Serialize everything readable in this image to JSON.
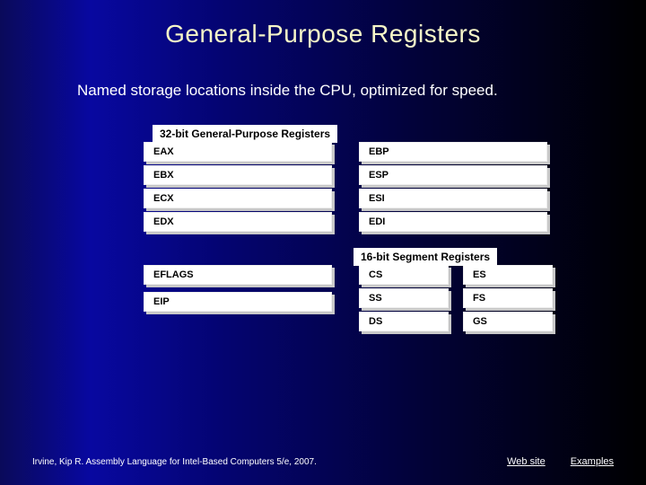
{
  "title": "General-Purpose Registers",
  "subtitle": "Named storage locations inside the CPU, optimized for speed.",
  "section32": {
    "caption": "32-bit General-Purpose Registers",
    "left": [
      "EAX",
      "EBX",
      "ECX",
      "EDX"
    ],
    "right": [
      "EBP",
      "ESP",
      "ESI",
      "EDI"
    ]
  },
  "section16": {
    "caption": "16-bit Segment Registers",
    "flags": [
      "EFLAGS",
      "EIP"
    ],
    "seg_left": [
      "CS",
      "SS",
      "DS"
    ],
    "seg_right": [
      "ES",
      "FS",
      "GS"
    ]
  },
  "footer": {
    "credit": "Irvine, Kip R. Assembly Language for Intel-Based Computers 5/e, 2007.",
    "link1": "Web site",
    "link2": "Examples"
  }
}
